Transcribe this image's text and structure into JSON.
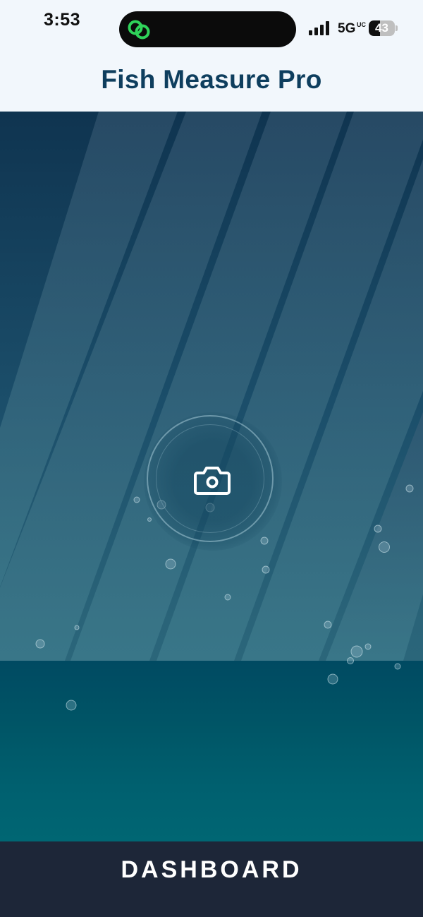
{
  "status_bar": {
    "time": "3:53",
    "network": "5G",
    "network_suffix": "UC",
    "battery_level": "43",
    "battery_fraction": 0.43,
    "icons": [
      "link-icon",
      "signal-icon",
      "battery-icon"
    ],
    "link_icon_color": "#2fd35a"
  },
  "header": {
    "title": "Fish Measure Pro"
  },
  "main": {
    "camera_button_icon": "camera-icon"
  },
  "footer": {
    "dashboard_label": "DASHBOARD"
  },
  "colors": {
    "title": "#0e3e5e",
    "bottom_bar": "#1d2638",
    "water": "#005566"
  }
}
